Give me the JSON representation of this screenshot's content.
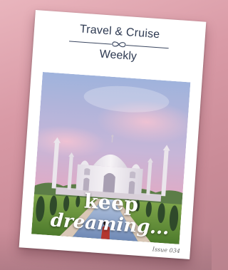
{
  "magazine": {
    "title_line1": "Travel & Cruise",
    "title_line2": "Weekly",
    "tagline_line1": "keep",
    "tagline_line2": "dreaming...",
    "issue": "Issue 034"
  },
  "colors": {
    "masthead_text": "#2e3a52",
    "background": "#d99aa6",
    "sky_top": "#a7b8de",
    "sky_bottom": "#e7a6c0",
    "marble": "#f2eef2",
    "lawn": "#7aa048",
    "cypress": "#2f4a2a"
  },
  "icons": {
    "divider": "infinity-ornament-icon"
  }
}
